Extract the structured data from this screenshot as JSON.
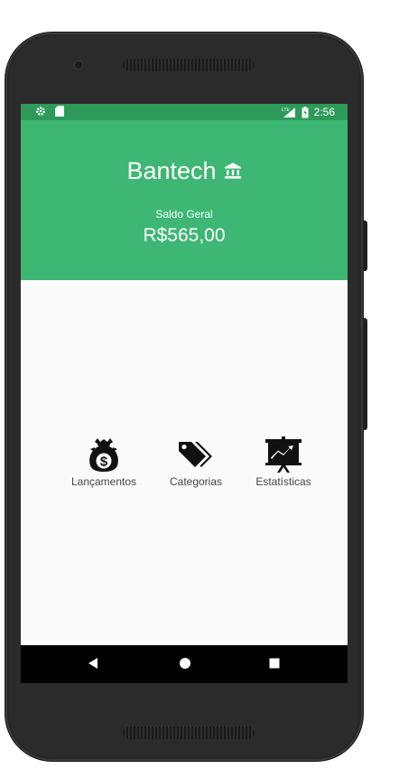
{
  "status_bar": {
    "time": "2:56",
    "network": "LTE"
  },
  "header": {
    "title": "Bantech",
    "balance_label": "Saldo Geral",
    "balance_value": "R$565,00"
  },
  "menu": [
    {
      "label": "Lançamentos",
      "icon": "money-bag-icon"
    },
    {
      "label": "Categorias",
      "icon": "tags-icon"
    },
    {
      "label": "Estatísticas",
      "icon": "chart-board-icon"
    }
  ],
  "colors": {
    "primary": "#3db773",
    "primary_dark": "#2e9a5a"
  }
}
